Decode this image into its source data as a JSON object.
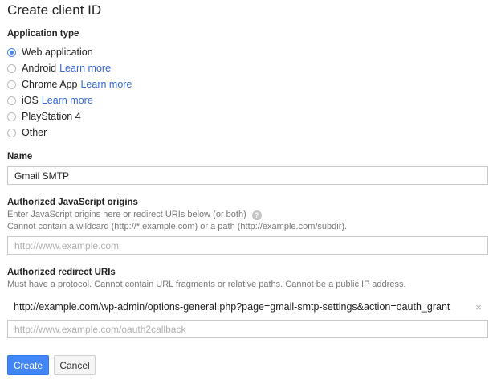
{
  "title": "Create client ID",
  "application_type": {
    "label": "Application type",
    "options": [
      {
        "label": "Web application",
        "link": ""
      },
      {
        "label": "Android",
        "link": "Learn more"
      },
      {
        "label": "Chrome App",
        "link": "Learn more"
      },
      {
        "label": "iOS",
        "link": "Learn more"
      },
      {
        "label": "PlayStation 4",
        "link": ""
      },
      {
        "label": "Other",
        "link": ""
      }
    ],
    "selected": "Web application"
  },
  "name": {
    "label": "Name",
    "value": "Gmail SMTP"
  },
  "js_origins": {
    "label": "Authorized JavaScript origins",
    "help_line1": "Enter JavaScript origins here or redirect URIs below (or both)",
    "help_line2": "Cannot contain a wildcard (http://*.example.com) or a path (http://example.com/subdir).",
    "help_icon": "?",
    "placeholder": "http://www.example.com"
  },
  "redirect_uris": {
    "label": "Authorized redirect URIs",
    "help": "Must have a protocol. Cannot contain URL fragments or relative paths. Cannot be a public IP address.",
    "items": [
      "http://example.com/wp-admin/options-general.php?page=gmail-smtp-settings&action=oauth_grant"
    ],
    "remove_icon": "×",
    "placeholder": "http://www.example.com/oauth2callback"
  },
  "buttons": {
    "create": "Create",
    "cancel": "Cancel"
  }
}
